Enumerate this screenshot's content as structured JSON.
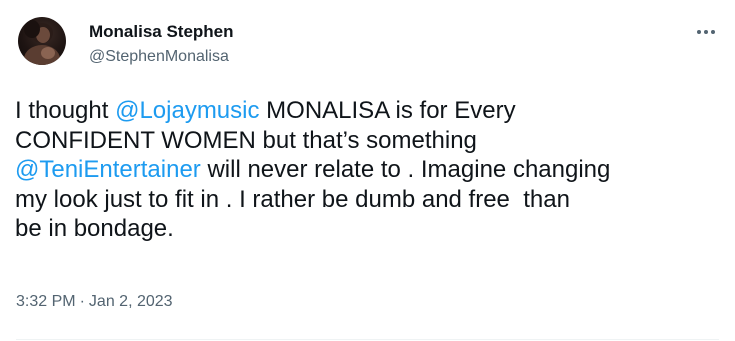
{
  "user": {
    "name": "Monalisa Stephen",
    "handle": "@StephenMonalisa"
  },
  "tweet": {
    "part1": "I thought ",
    "mention1": "@Lojaymusic",
    "part2": " MONALISA is for Every\nCONFIDENT WOMEN but that’s something\n",
    "mention2": "@TeniEntertainer",
    "part3": " will never relate to . Imagine changing\nmy look just to fit in . I rather be dumb and free  than\nbe in bondage."
  },
  "meta": {
    "time": "3:32 PM",
    "separator": "·",
    "date": "Jan 2, 2023"
  },
  "icons": {
    "more": "more-horizontal-icon"
  },
  "colors": {
    "link": "#1d9bf0",
    "text": "#0f1419",
    "secondary": "#536471"
  }
}
